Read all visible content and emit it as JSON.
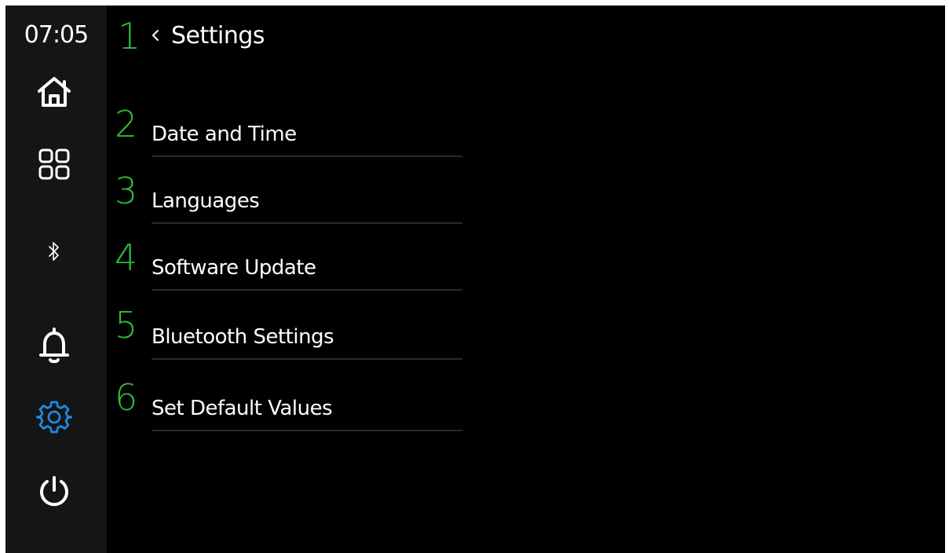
{
  "status": {
    "clock": "07:05"
  },
  "sidebar": {
    "items": [
      {
        "icon": "home-icon",
        "active": false
      },
      {
        "icon": "apps-grid-icon",
        "active": false
      },
      {
        "icon": "bluetooth-icon",
        "active": false
      },
      {
        "icon": "bell-icon",
        "active": false
      },
      {
        "icon": "gear-icon",
        "active": true
      },
      {
        "icon": "power-icon",
        "active": false
      }
    ],
    "active_color": "#1e88e5",
    "icon_color": "#ffffff"
  },
  "header": {
    "back_icon": "chevron-left-icon",
    "title": "Settings",
    "marker": "1"
  },
  "menu": [
    {
      "marker": "2",
      "label": "Date and Time"
    },
    {
      "marker": "3",
      "label": "Languages"
    },
    {
      "marker": "4",
      "label": "Software Update"
    },
    {
      "marker": "5",
      "label": "Bluetooth Settings"
    },
    {
      "marker": "6",
      "label": "Set Default Values"
    }
  ],
  "colors": {
    "background": "#000000",
    "sidebar": "#151515",
    "marker": "#2dbb3a",
    "text": "#ffffff",
    "divider": "#2a2a2a"
  }
}
